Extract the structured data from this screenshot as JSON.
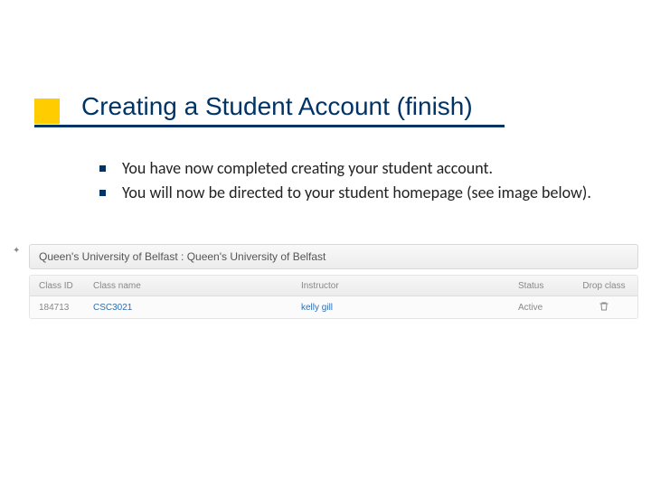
{
  "title": "Creating a Student Account (finish)",
  "bullets": [
    "You have now completed creating your student account.",
    "You will now be directed to your student homepage (see image below)."
  ],
  "screenshot": {
    "breadcrumb": "Queen's University of Belfast : Queen's University of Belfast",
    "headers": {
      "class_id": "Class ID",
      "class_name": "Class name",
      "instructor": "Instructor",
      "status": "Status",
      "drop": "Drop class"
    },
    "row": {
      "class_id": "184713",
      "class_name": "CSC3021",
      "instructor": "kelly gill",
      "status": "Active"
    },
    "icons": {
      "star": "star-icon",
      "trash": "trash-icon"
    }
  }
}
